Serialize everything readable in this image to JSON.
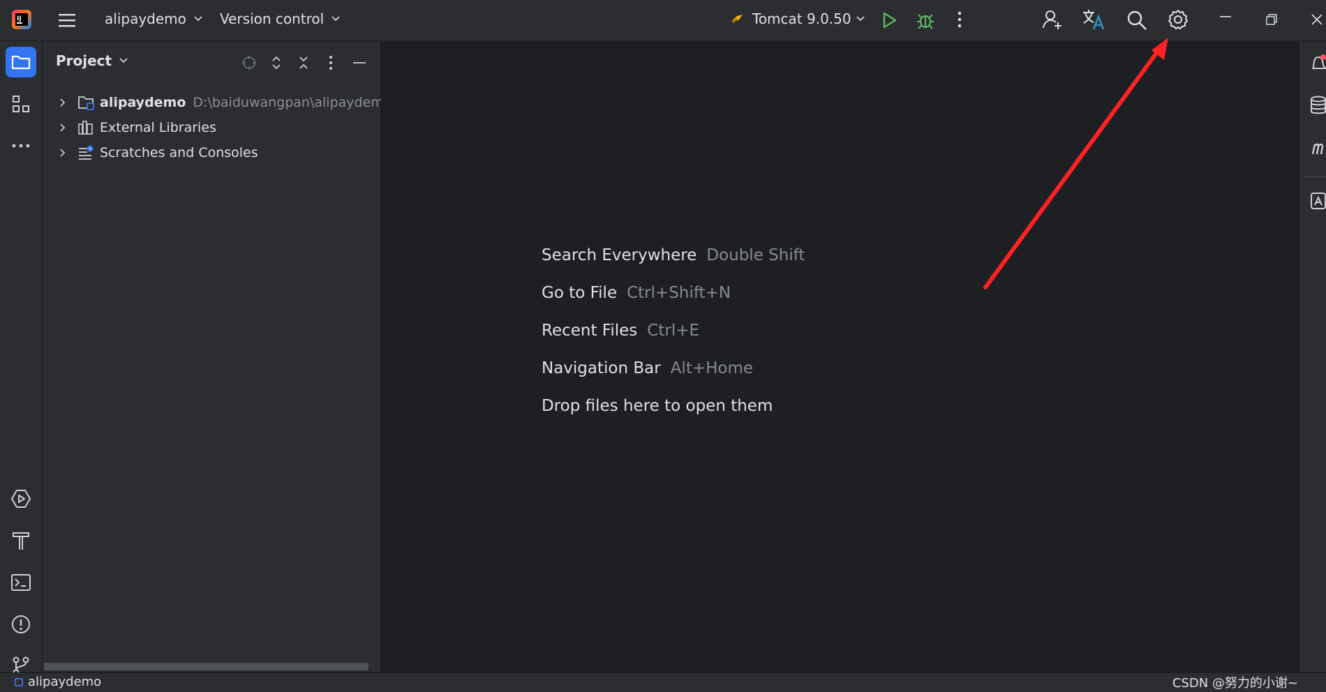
{
  "titlebar": {
    "project_name": "alipaydemo",
    "vcs_label": "Version control",
    "run_config": "Tomcat 9.0.50"
  },
  "project_panel": {
    "title": "Project",
    "tree": [
      {
        "label": "alipaydemo",
        "path": "D:\\baiduwangpan\\alipaydemo",
        "bold": true
      },
      {
        "label": "External Libraries",
        "path": ""
      },
      {
        "label": "Scratches and Consoles",
        "path": ""
      }
    ]
  },
  "editor": {
    "hints": [
      {
        "action": "Search Everywhere",
        "shortcut": "Double Shift"
      },
      {
        "action": "Go to File",
        "shortcut": "Ctrl+Shift+N"
      },
      {
        "action": "Recent Files",
        "shortcut": "Ctrl+E"
      },
      {
        "action": "Navigation Bar",
        "shortcut": "Alt+Home"
      },
      {
        "action": "Drop files here to open them",
        "shortcut": ""
      }
    ]
  },
  "statusbar": {
    "project": "alipaydemo"
  },
  "watermark": "CSDN @努力的小谢~",
  "colors": {
    "accent": "#3574f0",
    "run_green": "#5fb865",
    "annotation_arrow": "#ff2222"
  }
}
